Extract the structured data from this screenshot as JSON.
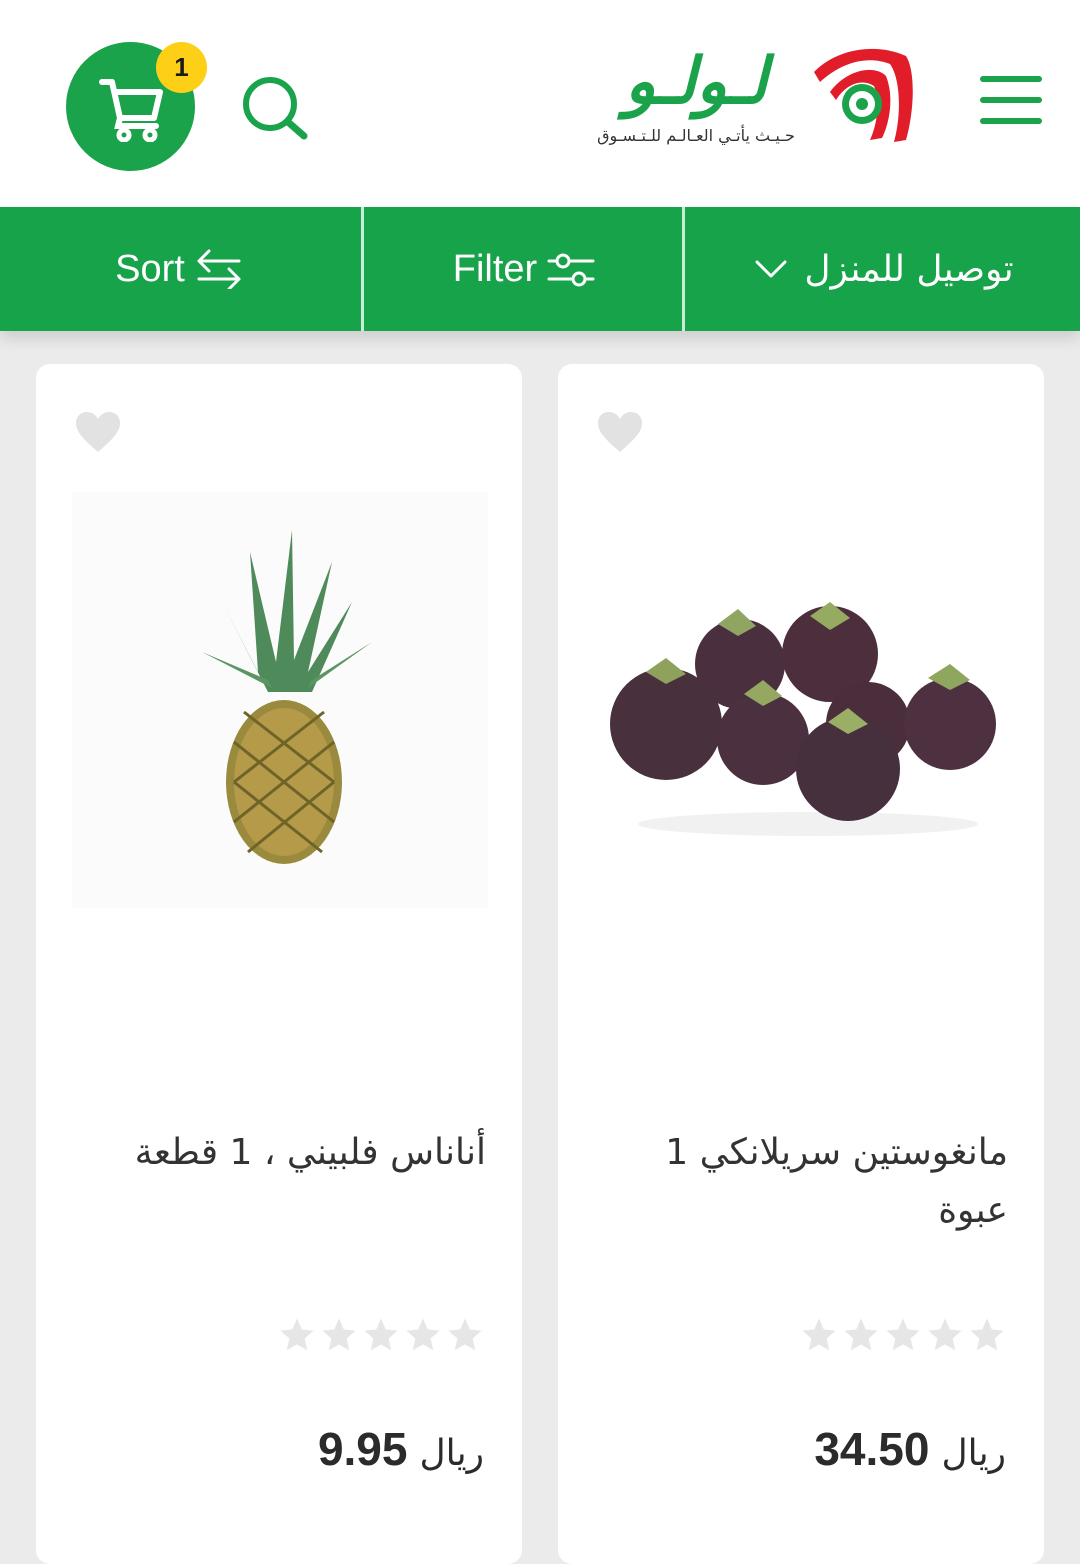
{
  "header": {
    "logo_text": "لـولـو",
    "logo_tagline": "حـيـث يأتـي العـالـم للـتـسـوق",
    "cart_count": "1",
    "icons": [
      "cart-icon",
      "search-icon",
      "menu-icon"
    ],
    "brand_color": "#1aa34a",
    "badge_color": "#fdd017"
  },
  "toolbar": {
    "sort_label": "Sort",
    "filter_label": "Filter",
    "delivery_label": "توصيل للمنزل"
  },
  "products": [
    {
      "title": "مانغوستين سريلانكي 1 عبوة",
      "currency": "ريال",
      "price": "34.50",
      "rating": 0,
      "image": "mangosteen"
    },
    {
      "title": "أناناس فلبيني ، 1 قطعة",
      "currency": "ريال",
      "price": "9.95",
      "rating": 0,
      "image": "pineapple"
    }
  ]
}
